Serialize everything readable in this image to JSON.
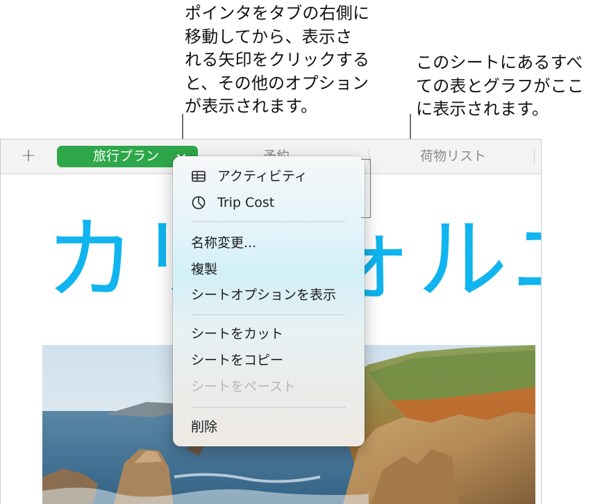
{
  "callouts": {
    "left": "ポインタをタブの右側に\n移動してから、表示さ\nれる矢印をクリックする\nと、その他のオプション\nが表示されます。",
    "right": "このシートにあるすべ\nての表とグラフがここ\nに表示されます。"
  },
  "tabbar": {
    "add_label": "+",
    "active_tab": "旅行プラン",
    "tabs": [
      "予約",
      "荷物リスト"
    ]
  },
  "canvas": {
    "title": "カリフォルニア"
  },
  "menu": {
    "objects": [
      {
        "label": "アクティビティ",
        "icon": "table-icon"
      },
      {
        "label": "Trip Cost",
        "icon": "pie-chart-icon"
      }
    ],
    "group1": [
      "名称変更...",
      "複製",
      "シートオプションを表示"
    ],
    "group2": [
      "シートをカット",
      "シートをコピー",
      "シートをペースト"
    ],
    "group3": [
      "削除"
    ]
  },
  "colors": {
    "active_tab": "#2ea74a",
    "title": "#10b4ee"
  }
}
